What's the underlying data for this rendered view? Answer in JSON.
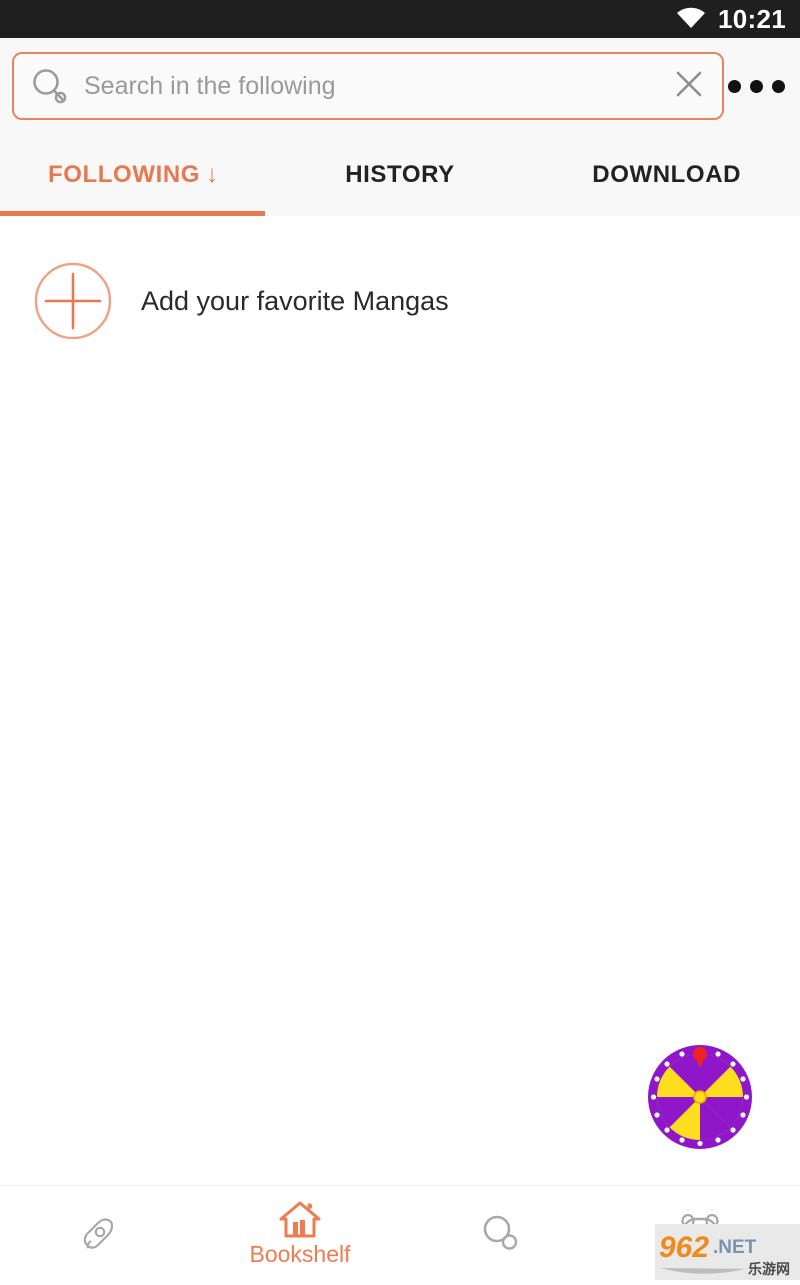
{
  "status_bar": {
    "time": "10:21",
    "wifi_icon": "wifi-icon",
    "background": "#1f1f1f"
  },
  "theme": {
    "accent": "#e8794f",
    "accent_border": "#e8835e",
    "header_bg": "#f8f8f8",
    "content_bg": "#ffffff",
    "muted_text": "#9a9a9a",
    "nav_icon": "#9e9e9e"
  },
  "search": {
    "placeholder": "Search in the following",
    "value": "",
    "search_icon": "search-icon",
    "clear_icon": "close-icon"
  },
  "overflow": {
    "icon": "more-options-icon",
    "dots": 3
  },
  "tabs": [
    {
      "label": "FOLLOWING",
      "arrow": "↓",
      "active": true
    },
    {
      "label": "HISTORY",
      "arrow": "",
      "active": false
    },
    {
      "label": "DOWNLOAD",
      "arrow": "",
      "active": false
    }
  ],
  "main": {
    "add_favorite": {
      "label": "Add your favorite Mangas",
      "icon": "plus-circle-icon"
    },
    "prize_wheel": {
      "icon": "prize-wheel-icon",
      "segment_colors": [
        "#8f17c9",
        "#ffdd1f"
      ],
      "pointer_color": "#ef2222",
      "segments": 8
    }
  },
  "bottom_nav": [
    {
      "icon": "rocket-icon",
      "label": "",
      "active": false
    },
    {
      "icon": "home-icon",
      "label": "Bookshelf",
      "active": true
    },
    {
      "icon": "search-icon",
      "label": "",
      "active": false
    },
    {
      "icon": "panda-icon",
      "label": "",
      "active": false
    }
  ],
  "watermark": {
    "primary": "962",
    "suffix": ".NET",
    "subtitle": "乐游网"
  }
}
